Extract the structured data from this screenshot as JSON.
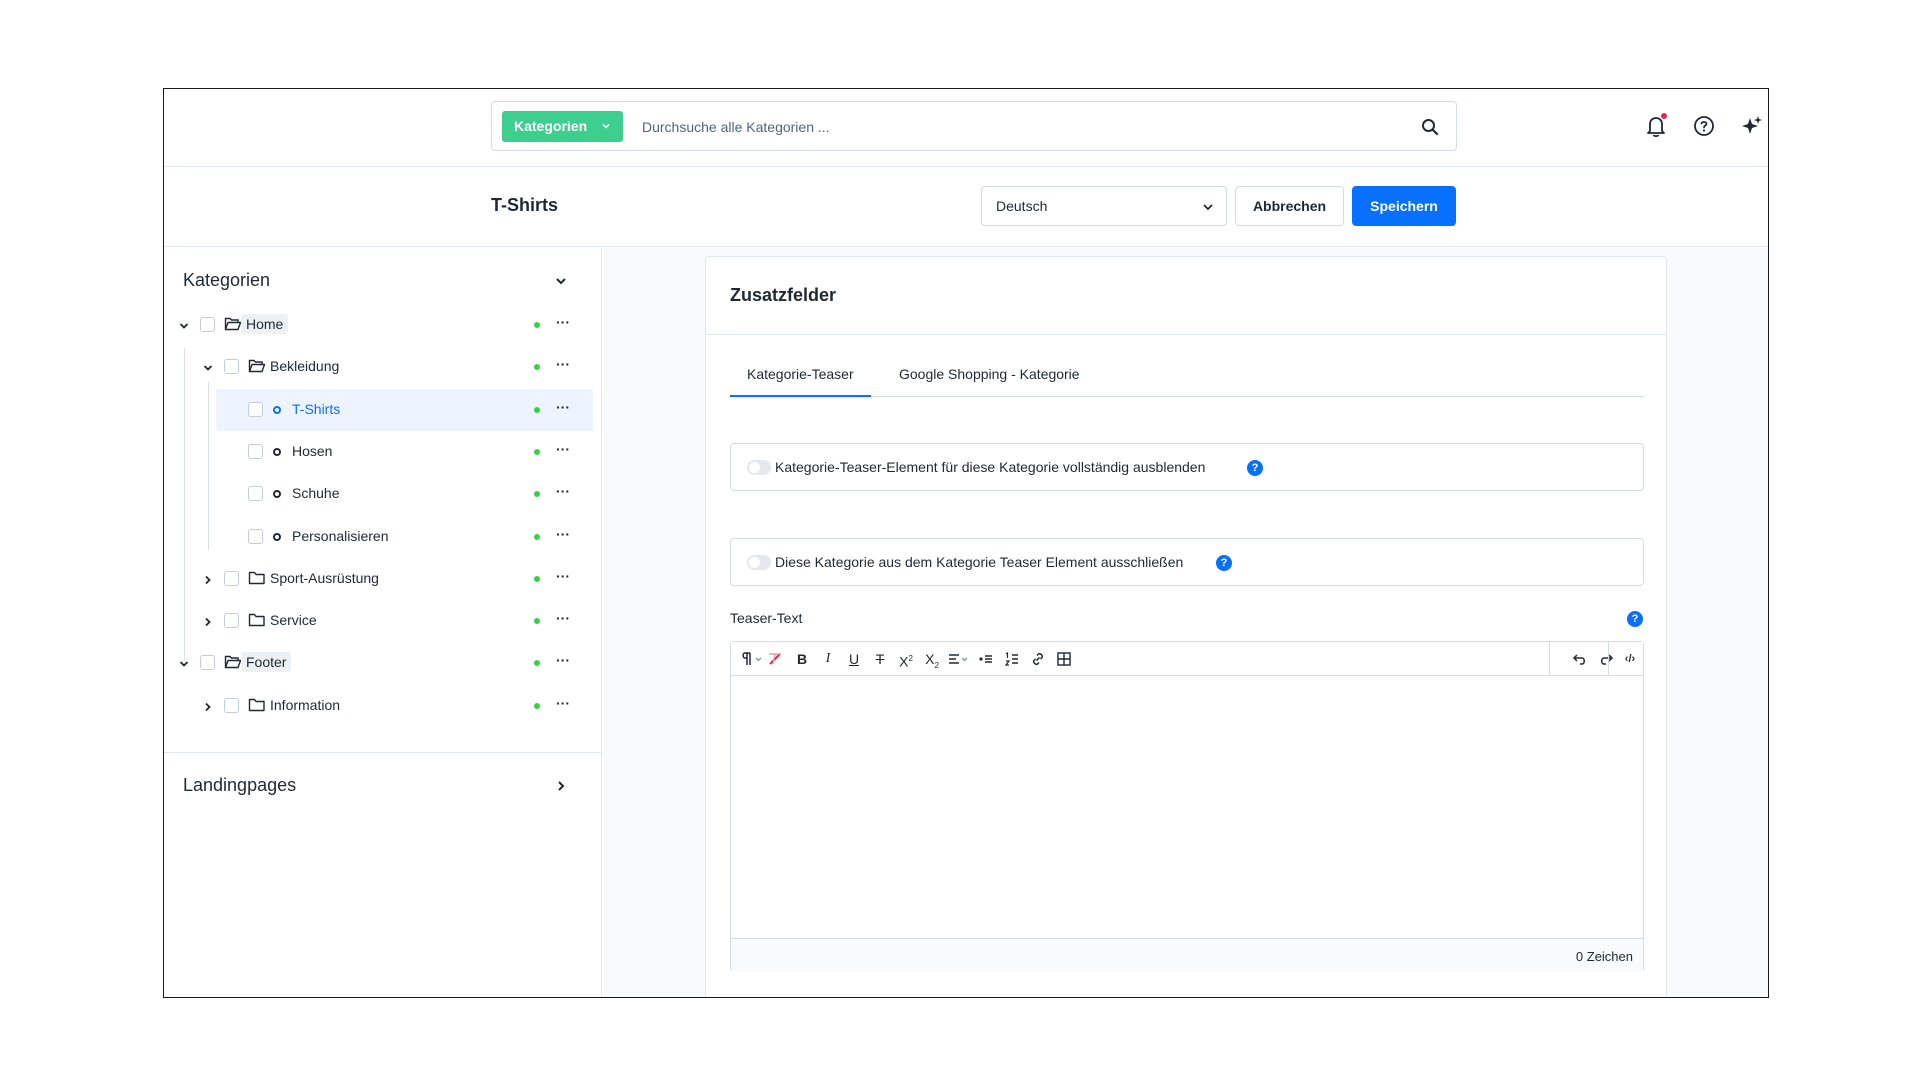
{
  "topbar": {
    "search_type": "Kategorien",
    "search_placeholder": "Durchsuche alle Kategorien ...",
    "icons": [
      "search-icon",
      "bell-icon",
      "help-icon",
      "sparkle-icon"
    ]
  },
  "page": {
    "title": "T-Shirts",
    "language": "Deutsch",
    "cancel_label": "Abbrechen",
    "save_label": "Speichern"
  },
  "sidebar": {
    "categories_title": "Kategorien",
    "landingpages_title": "Landingpages",
    "tree": [
      {
        "label": "Home",
        "level": 0,
        "expanded": true,
        "icon": "folder-open-icon"
      },
      {
        "label": "Bekleidung",
        "level": 1,
        "expanded": true,
        "icon": "folder-open-icon"
      },
      {
        "label": "T-Shirts",
        "level": 2,
        "icon": "leaf-dot",
        "selected": true
      },
      {
        "label": "Hosen",
        "level": 2,
        "icon": "leaf-dot"
      },
      {
        "label": "Schuhe",
        "level": 2,
        "icon": "leaf-dot"
      },
      {
        "label": "Personalisieren",
        "level": 2,
        "icon": "leaf-dot"
      },
      {
        "label": "Sport-Ausrüstung",
        "level": 1,
        "expanded": false,
        "icon": "folder-icon"
      },
      {
        "label": "Service",
        "level": 1,
        "expanded": false,
        "icon": "folder-icon"
      },
      {
        "label": "Footer",
        "level": 0,
        "expanded": true,
        "icon": "folder-open-icon"
      },
      {
        "label": "Information",
        "level": 1,
        "expanded": false,
        "icon": "folder-icon"
      }
    ]
  },
  "main": {
    "card_title": "Zusatzfelder",
    "tabs": [
      {
        "label": "Kategorie-Teaser",
        "active": true
      },
      {
        "label": "Google Shopping - Kategorie",
        "active": false
      }
    ],
    "toggle_1": "Kategorie-Teaser-Element für diese Kategorie vollständig ausblenden",
    "toggle_2": "Diese Kategorie aus dem Kategorie Teaser Element ausschließen",
    "help_mark": "?",
    "teaser_label": "Teaser-Text",
    "char_count": "0 Zeichen"
  },
  "colors": {
    "primary": "#0870ff",
    "search_type_bg": "#3ccf8e",
    "active_status": "#37d046",
    "notification": "#de294c"
  }
}
